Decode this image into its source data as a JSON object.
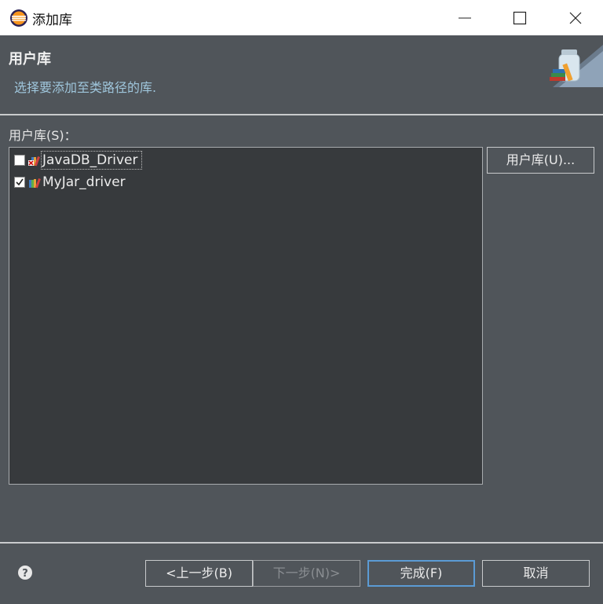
{
  "window": {
    "title": "添加库"
  },
  "header": {
    "title": "用户库",
    "description": "选择要添加至类路径的库."
  },
  "list": {
    "label": "用户库(S)：",
    "items": [
      {
        "label": "JavaDB_Driver",
        "checked": false
      },
      {
        "label": "MyJar_driver",
        "checked": true
      }
    ]
  },
  "buttons": {
    "user_libraries": "用户库(U)...",
    "back": "<上一步(B)",
    "next": "下一步(N)>",
    "finish": "完成(F)",
    "cancel": "取消"
  },
  "colors": {
    "background": "#50555a",
    "list_background": "#373a3d",
    "description_text": "#9fc6dc",
    "default_button_border": "#5b9bd5"
  },
  "icons": {
    "app": "eclipse-icon",
    "minimize": "minimize-icon",
    "maximize": "maximize-icon",
    "close": "close-icon",
    "banner": "library-banner-icon",
    "library": "library-icon",
    "library_error": "library-error-icon",
    "help": "help-icon"
  }
}
